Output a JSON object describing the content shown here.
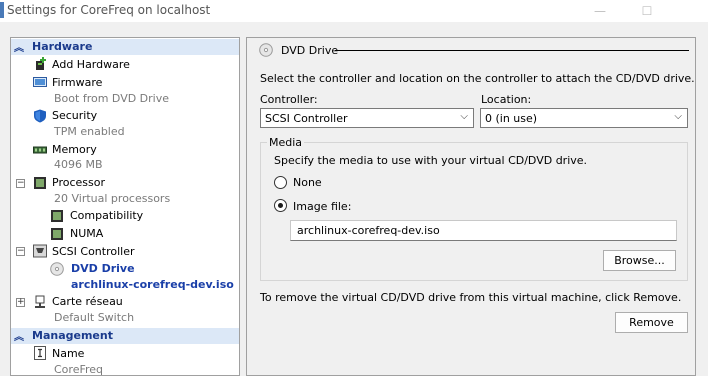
{
  "window": {
    "title": "Settings for CoreFreq on localhost",
    "minimize_glyph": "—",
    "maximize_glyph": "☐"
  },
  "tree": {
    "hardware_header": "Hardware",
    "management_header": "Management",
    "items": {
      "add_hardware": {
        "label": "Add Hardware"
      },
      "firmware": {
        "label": "Firmware",
        "sub": "Boot from DVD Drive"
      },
      "security": {
        "label": "Security",
        "sub": "TPM enabled"
      },
      "memory": {
        "label": "Memory",
        "sub": "4096 MB"
      },
      "processor": {
        "label": "Processor",
        "sub": "20 Virtual processors"
      },
      "compatibility": {
        "label": "Compatibility"
      },
      "numa": {
        "label": "NUMA"
      },
      "scsi": {
        "label": "SCSI Controller"
      },
      "dvd": {
        "label": "DVD Drive",
        "sub": "archlinux-corefreq-dev.iso"
      },
      "network": {
        "label": "Carte réseau",
        "sub": "Default Switch"
      },
      "name": {
        "label": "Name",
        "sub": "CoreFreq"
      }
    },
    "icons": [
      "add-hardware-icon",
      "firmware-icon",
      "shield-icon",
      "memory-icon",
      "processor-icon",
      "scsi-icon",
      "dvd-icon",
      "network-icon",
      "name-icon"
    ]
  },
  "dvd_panel": {
    "heading": "DVD Drive",
    "intro": "Select the controller and location on the controller to attach the CD/DVD drive.",
    "controller_label": "Controller:",
    "controller_value": "SCSI Controller",
    "location_label": "Location:",
    "location_value": "0 (in use)",
    "media_group": "Media",
    "media_intro": "Specify the media to use with your virtual CD/DVD drive.",
    "none_label": "None",
    "image_label": "Image file:",
    "image_path": "archlinux-corefreq-dev.iso",
    "selected_media": "Image file:",
    "browse_label": "Browse...",
    "remove_text": "To remove the virtual CD/DVD drive from this virtual machine, click Remove.",
    "remove_label": "Remove"
  },
  "colors": {
    "section_header_bg": "#dce8f7",
    "section_header_text": "#1a3a8c",
    "selected_text": "#1a3fa8"
  }
}
